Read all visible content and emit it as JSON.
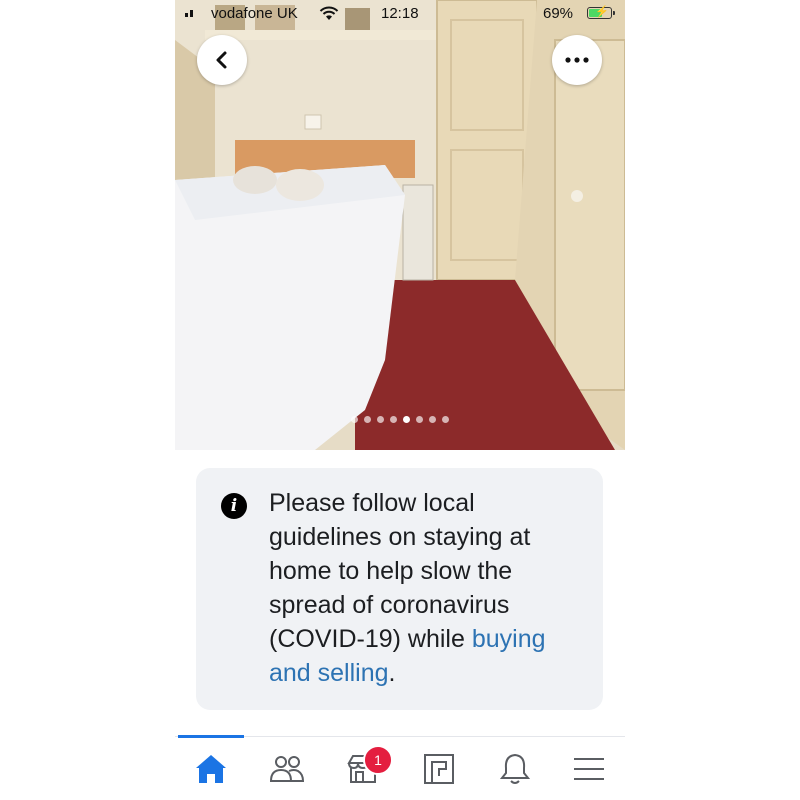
{
  "status_bar": {
    "carrier": "vodafone UK",
    "time": "12:18",
    "battery_percent": "69%",
    "battery_level": 0.69,
    "icons": [
      "cellular-signal-icon",
      "wifi-icon",
      "battery-charging-icon"
    ]
  },
  "photo": {
    "description_icon": "bedroom-photo",
    "pager": {
      "total": 8,
      "active_index": 4
    }
  },
  "top_buttons": {
    "back_icon": "chevron-left-icon",
    "more_icon": "more-dots-icon"
  },
  "notice": {
    "icon": "info-icon",
    "text": "Please follow local guidelines on staying at home to help slow the spread of coronavirus (COVID-19) while ",
    "link_text": "buying and selling",
    "trailing": "."
  },
  "tab_bar": {
    "active": "home",
    "tabs": [
      {
        "id": "home",
        "icon": "home-icon"
      },
      {
        "id": "friends",
        "icon": "friends-icon"
      },
      {
        "id": "marketplace",
        "icon": "marketplace-icon",
        "badge": "1"
      },
      {
        "id": "pages",
        "icon": "pages-icon"
      },
      {
        "id": "notifications",
        "icon": "bell-icon"
      },
      {
        "id": "menu",
        "icon": "menu-icon"
      }
    ]
  },
  "colors": {
    "accent_blue": "#1b74e4",
    "link_blue": "#2d73b3",
    "badge_red": "#e41e3f",
    "card_bg": "#f0f2f5"
  }
}
